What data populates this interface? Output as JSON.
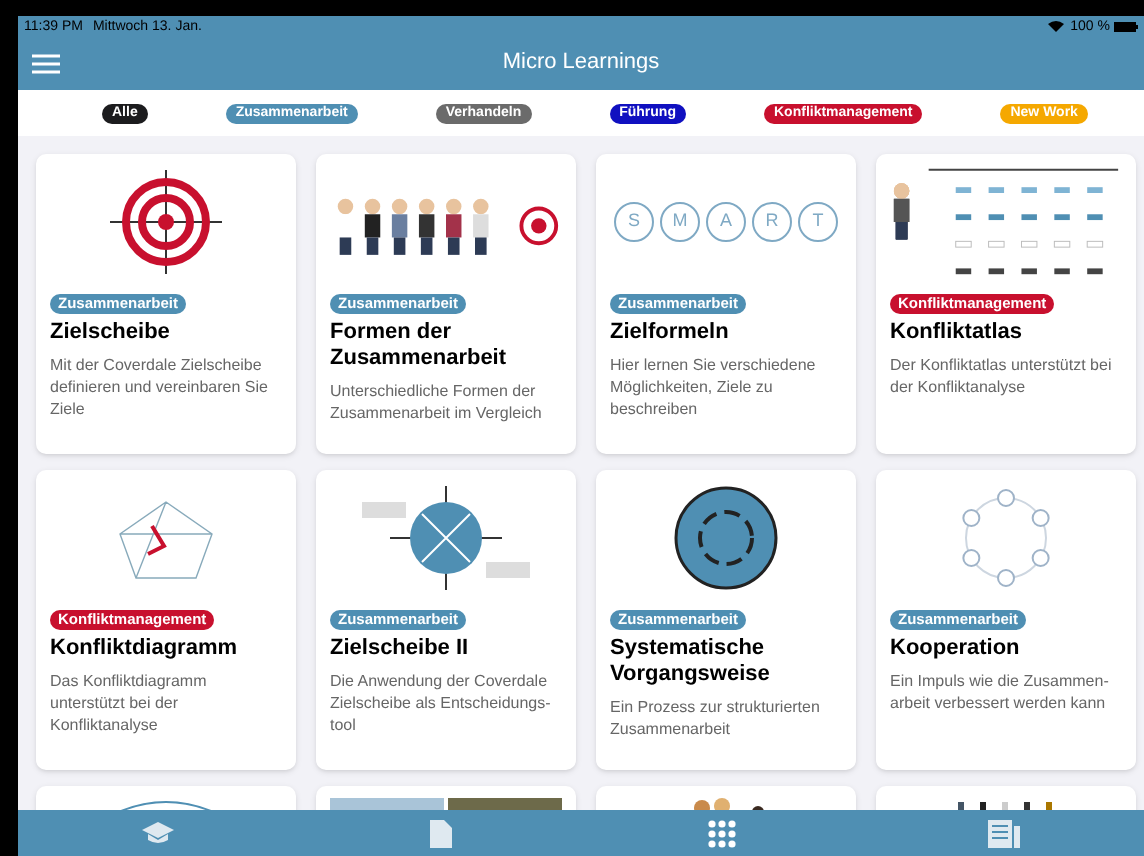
{
  "status_bar": {
    "time": "11:39 PM",
    "date": "Mittwoch 13. Jan.",
    "battery": "100 %"
  },
  "header": {
    "title": "Micro Learnings"
  },
  "filters": [
    {
      "label": "Alle",
      "color": "#1c1c1e"
    },
    {
      "label": "Zusammenarbeit",
      "color": "#4f8fb3"
    },
    {
      "label": "Verhandeln",
      "color": "#6b6b6b"
    },
    {
      "label": "Führung",
      "color": "#1010c0"
    },
    {
      "label": "Konfliktmanagement",
      "color": "#c8102e"
    },
    {
      "label": "New Work",
      "color": "#f5a800"
    }
  ],
  "cards": [
    {
      "kind": "target",
      "tag": "Zusammenarbeit",
      "color": "#4f8fb3",
      "title": "Zielscheibe",
      "description": "Mit der Coverdale Zielscheibe definieren und vereinbaren Sie Ziele"
    },
    {
      "kind": "people",
      "tag": "Zusammenarbeit",
      "color": "#4f8fb3",
      "title": "Formen der Zusammenarbeit",
      "description": "Unterschiedliche Formen der Zusammenarbeit im Vergleich"
    },
    {
      "kind": "smart",
      "letters": [
        "S",
        "M",
        "A",
        "R",
        "T"
      ],
      "tag": "Zusammenarbeit",
      "color": "#4f8fb3",
      "title": "Zielformeln",
      "description": "Hier lernen Sie verschiedene Möglichkeiten, Ziele zu beschreiben"
    },
    {
      "kind": "atlas",
      "tag": "Konfliktmanagement",
      "color": "#c8102e",
      "title": "Konfliktatlas",
      "description": "Der Konfliktatlas unterstützt bei der Konfliktanalyse"
    },
    {
      "kind": "network",
      "tag": "Konfliktmanagement",
      "color": "#c8102e",
      "title": "Konfliktdiagramm",
      "description": "Das Konfliktdiagramm unterstützt bei der Konfliktanalyse"
    },
    {
      "kind": "target2",
      "tag": "Zusammenarbeit",
      "color": "#4f8fb3",
      "title": "Zielscheibe II",
      "description": "Die Anwendung der Coverdale Zielscheibe als Entscheidungs-tool"
    },
    {
      "kind": "wheel",
      "tag": "Zusammenarbeit",
      "color": "#4f8fb3",
      "title": "Systematische Vorgangsweise",
      "description": "Ein Prozess zur strukturierten Zusammenarbeit"
    },
    {
      "kind": "cycle",
      "tag": "Zusammenarbeit",
      "color": "#4f8fb3",
      "title": "Kooperation",
      "description": "Ein Impuls wie die Zusammen-arbeit verbessert werden kann"
    },
    {
      "kind": "arc"
    },
    {
      "kind": "photo"
    },
    {
      "kind": "heads"
    },
    {
      "kind": "figures"
    }
  ],
  "tab_bar": [
    {
      "kind": "cap",
      "selected": false
    },
    {
      "kind": "file",
      "selected": false
    },
    {
      "kind": "grid",
      "selected": true
    },
    {
      "kind": "news",
      "selected": false
    }
  ]
}
